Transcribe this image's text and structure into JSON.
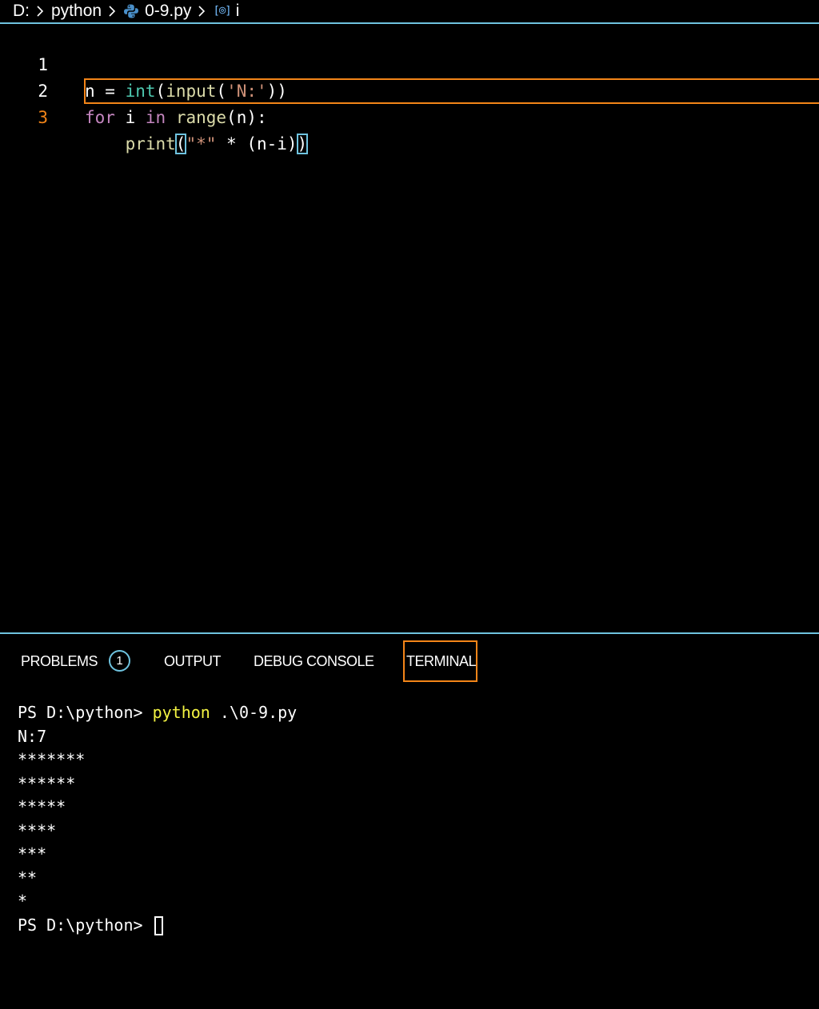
{
  "breadcrumb": {
    "drive": "D:",
    "folder": "python",
    "file": "0-9.py",
    "symbol": "i",
    "symbol_icon_text": "[⌾]"
  },
  "editor": {
    "lines": [
      {
        "number": "1",
        "tokens": [
          {
            "text": "n",
            "kind": "var"
          },
          {
            "text": " = ",
            "kind": "op"
          },
          {
            "text": "int",
            "kind": "builtin"
          },
          {
            "text": "(",
            "kind": "punc"
          },
          {
            "text": "input",
            "kind": "fn"
          },
          {
            "text": "(",
            "kind": "punc"
          },
          {
            "text": "'N:'",
            "kind": "str"
          },
          {
            "text": "))",
            "kind": "punc"
          }
        ]
      },
      {
        "number": "2",
        "tokens": [
          {
            "text": "for",
            "kind": "kw"
          },
          {
            "text": " i ",
            "kind": "var"
          },
          {
            "text": "in",
            "kind": "kw"
          },
          {
            "text": " ",
            "kind": "op"
          },
          {
            "text": "range",
            "kind": "fn"
          },
          {
            "text": "(n):",
            "kind": "punc"
          }
        ]
      },
      {
        "number": "3",
        "tokens": [
          {
            "text": "    ",
            "kind": "op"
          },
          {
            "text": "print",
            "kind": "fn"
          },
          {
            "text": "(",
            "kind": "punc",
            "match": true
          },
          {
            "text": "\"*\"",
            "kind": "str"
          },
          {
            "text": " * (n-i)",
            "kind": "op"
          },
          {
            "text": ")",
            "kind": "punc",
            "match": true
          }
        ]
      }
    ],
    "active_line": "3"
  },
  "panel": {
    "tabs": [
      {
        "key": "problems",
        "label": "PROBLEMS",
        "badge": "1"
      },
      {
        "key": "output",
        "label": "OUTPUT"
      },
      {
        "key": "debug",
        "label": "DEBUG CONSOLE"
      },
      {
        "key": "terminal",
        "label": "TERMINAL",
        "active": true
      }
    ]
  },
  "terminal": {
    "prompt": "PS D:\\python> ",
    "command": "python",
    "command_args": " .\\0-9.py",
    "output_lines": [
      "N:7",
      "*******",
      "******",
      "*****",
      "****",
      "***",
      "**",
      "*"
    ]
  },
  "colors": {
    "focus_border": "#6fc3df",
    "active_outline": "#f38518",
    "command_yellow": "#f5f543",
    "string": "#ce9178",
    "keyword": "#c586c0",
    "function": "#dcdcaa",
    "builtin": "#4ec9b0"
  }
}
